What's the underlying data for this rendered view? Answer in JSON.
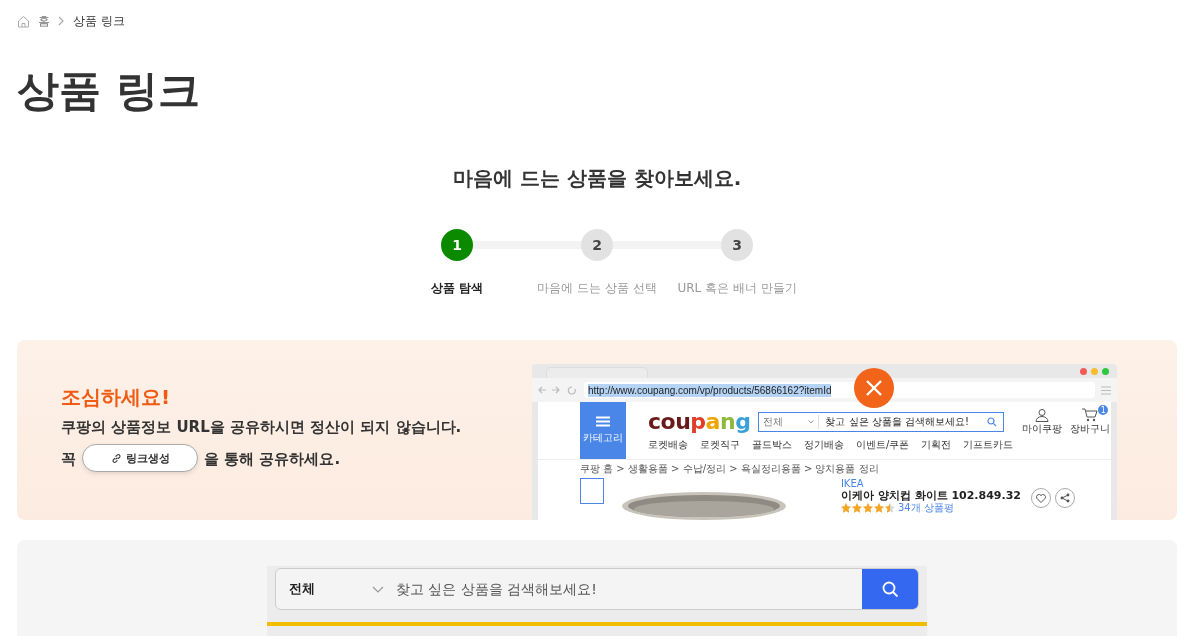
{
  "breadcrumb": [
    {
      "label": "홈",
      "kind": "home"
    },
    {
      "label": "상품 링크",
      "kind": "page"
    }
  ],
  "title": "상품 링크",
  "subtitle": "마음에 드는 상품을 찾아보세요.",
  "steps": [
    {
      "number": "1",
      "label": "상품 탐색",
      "selected": true
    },
    {
      "number": "2",
      "label": "마음에 드는 상품 선택",
      "selected": false
    },
    {
      "number": "3",
      "label": "URL 혹은 배너 만들기",
      "selected": false
    }
  ],
  "warning": {
    "title": "조심하세요!",
    "line1": "쿠팡의 상품정보 URL을 공유하시면 정산이 되지 않습니다.",
    "prefix": "꼭",
    "button": "링크생성",
    "suffix": "을 통해 공유하세요."
  },
  "mockup": {
    "url": "http://www.coupang.com/vp/products/56866162?itemId",
    "logo": "coupang",
    "category": "카테고리",
    "scope": "전체",
    "placeholder": "찾고 싶은 상품을 검색해보세요!",
    "account": "마이쿠팡",
    "cart": "장바구니",
    "cart_count": "1",
    "nav": [
      "로켓배송",
      "로켓직구",
      "골드박스",
      "정기배송",
      "이벤트/쿠폰",
      "기획전",
      "기프트카드"
    ],
    "crumbs": "쿠팡 홈 > 생활용품 > 수납/정리 > 욕실정리용품 > 양치용품 정리",
    "brand": "IKEA",
    "product": "이케아 양치컵 화이트 102.849.32",
    "stars": 4.5,
    "reviews": "34개 상품평"
  },
  "search": {
    "scope": "전체",
    "placeholder": "찾고 싶은 상품을 검색해보세요!"
  }
}
